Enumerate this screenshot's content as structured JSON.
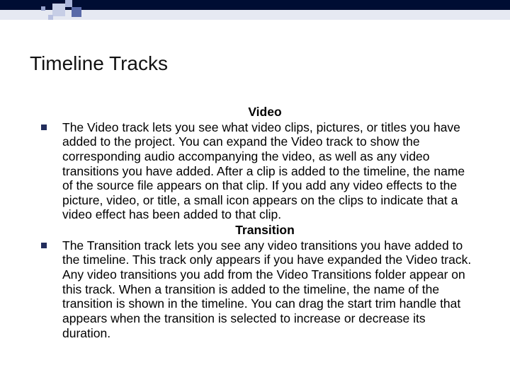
{
  "title": "Timeline Tracks",
  "sections": [
    {
      "heading": "Video",
      "text": "The Video track lets you see what video clips, pictures, or titles you have added to the project. You can expand the Video track to show the corresponding audio accompanying the video, as well as any video transitions you have added. After a clip is added to the timeline, the name of the source file appears on that clip. If you add any video effects to the picture, video, or title, a small icon appears on the clips to indicate that a video effect has been added to that clip."
    },
    {
      "heading": "Transition",
      "text": "The Transition track lets you see any video transitions you have added to the timeline. This track only appears if you have expanded the Video track. Any video transitions you add from the Video Transitions folder appear on this track. When a transition is added to the timeline, the name of the transition is shown in the timeline. You can drag the start trim handle that appears when the transition is selected to increase or decrease its duration."
    }
  ]
}
